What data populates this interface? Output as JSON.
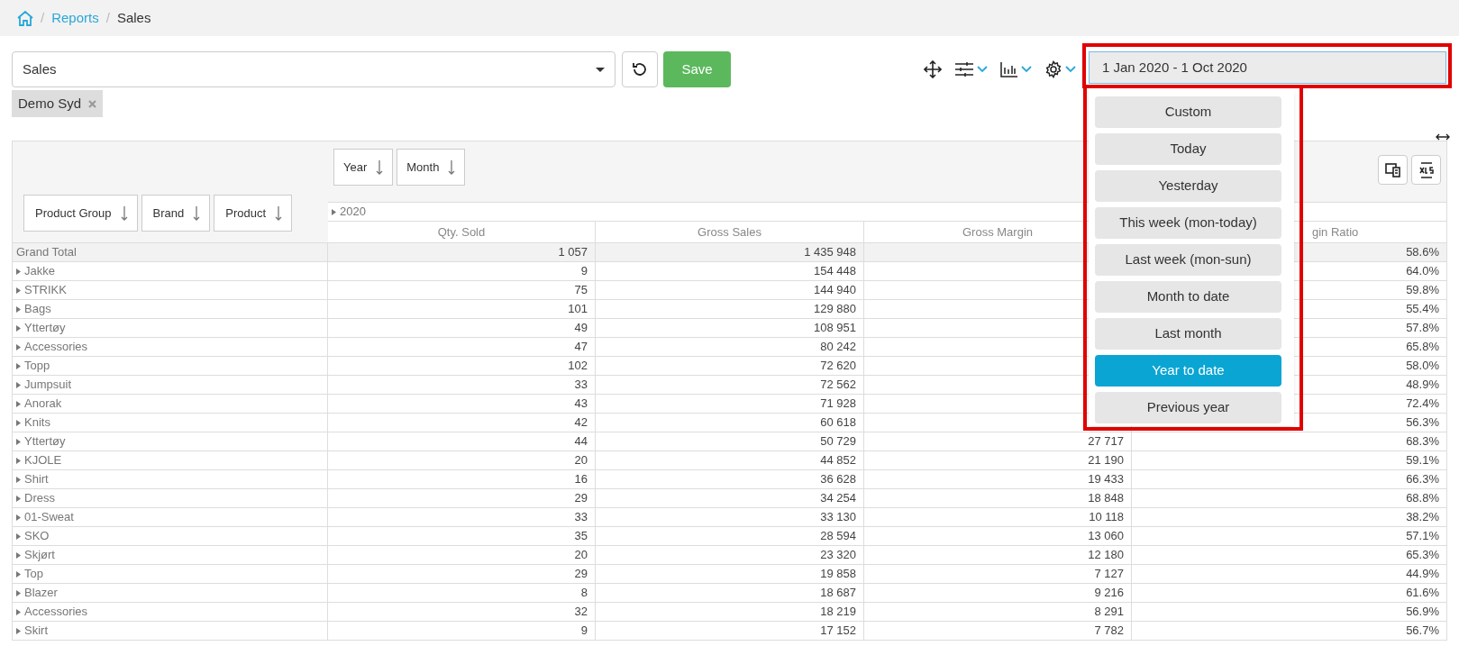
{
  "breadcrumb": [
    {
      "separator": "/",
      "label": "Reports",
      "link": true
    },
    {
      "separator": "/",
      "label": "Sales",
      "link": false
    }
  ],
  "report_select": {
    "value": "Sales"
  },
  "save_button": "Save",
  "filter_tags": [
    "Demo Syd"
  ],
  "date_range": {
    "value": "1 Jan 2020 - 1 Oct 2020"
  },
  "date_presets": [
    {
      "label": "Custom",
      "selected": false
    },
    {
      "label": "Today",
      "selected": false
    },
    {
      "label": "Yesterday",
      "selected": false
    },
    {
      "label": "This week (mon-today)",
      "selected": false
    },
    {
      "label": "Last week (mon-sun)",
      "selected": false
    },
    {
      "label": "Month to date",
      "selected": false
    },
    {
      "label": "Last month",
      "selected": false
    },
    {
      "label": "Year to date",
      "selected": true
    },
    {
      "label": "Previous year",
      "selected": false
    }
  ],
  "pivot": {
    "column_fields": [
      "Year",
      "Month"
    ],
    "row_fields": [
      "Product Group",
      "Brand",
      "Product"
    ],
    "column_group": "2020",
    "columns": [
      "Qty. Sold",
      "Gross Sales",
      "Gross Margin",
      "gin Ratio"
    ],
    "rows": [
      {
        "name": "Grand Total",
        "expandable": false,
        "cells": [
          "1 057",
          "1 435 948",
          null,
          "58.6%"
        ]
      },
      {
        "name": "Jakke",
        "expandable": true,
        "cells": [
          "9",
          "154 448",
          null,
          "64.0%"
        ]
      },
      {
        "name": "STRIKK",
        "expandable": true,
        "cells": [
          "75",
          "144 940",
          null,
          "59.8%"
        ]
      },
      {
        "name": "Bags",
        "expandable": true,
        "cells": [
          "101",
          "129 880",
          null,
          "55.4%"
        ]
      },
      {
        "name": "Yttertøy",
        "expandable": true,
        "cells": [
          "49",
          "108 951",
          null,
          "57.8%"
        ]
      },
      {
        "name": "Accessories",
        "expandable": true,
        "cells": [
          "47",
          "80 242",
          null,
          "65.8%"
        ]
      },
      {
        "name": "Topp",
        "expandable": true,
        "cells": [
          "102",
          "72 620",
          null,
          "58.0%"
        ]
      },
      {
        "name": "Jumpsuit",
        "expandable": true,
        "cells": [
          "33",
          "72 562",
          null,
          "48.9%"
        ]
      },
      {
        "name": "Anorak",
        "expandable": true,
        "cells": [
          "43",
          "71 928",
          null,
          "72.4%"
        ]
      },
      {
        "name": "Knits",
        "expandable": true,
        "cells": [
          "42",
          "60 618",
          null,
          "56.3%"
        ]
      },
      {
        "name": "Yttertøy",
        "expandable": true,
        "cells": [
          "44",
          "50 729",
          "27 717",
          "68.3%"
        ]
      },
      {
        "name": "KJOLE",
        "expandable": true,
        "cells": [
          "20",
          "44 852",
          "21 190",
          "59.1%"
        ]
      },
      {
        "name": "Shirt",
        "expandable": true,
        "cells": [
          "16",
          "36 628",
          "19 433",
          "66.3%"
        ]
      },
      {
        "name": "Dress",
        "expandable": true,
        "cells": [
          "29",
          "34 254",
          "18 848",
          "68.8%"
        ]
      },
      {
        "name": "01-Sweat",
        "expandable": true,
        "cells": [
          "33",
          "33 130",
          "10 118",
          "38.2%"
        ]
      },
      {
        "name": "SKO",
        "expandable": true,
        "cells": [
          "35",
          "28 594",
          "13 060",
          "57.1%"
        ]
      },
      {
        "name": "Skjørt",
        "expandable": true,
        "cells": [
          "20",
          "23 320",
          "12 180",
          "65.3%"
        ]
      },
      {
        "name": "Top",
        "expandable": true,
        "cells": [
          "29",
          "19 858",
          "7 127",
          "44.9%"
        ]
      },
      {
        "name": "Blazer",
        "expandable": true,
        "cells": [
          "8",
          "18 687",
          "9 216",
          "61.6%"
        ]
      },
      {
        "name": "Accessories",
        "expandable": true,
        "cells": [
          "32",
          "18 219",
          "8 291",
          "56.9%"
        ]
      },
      {
        "name": "Skirt",
        "expandable": true,
        "cells": [
          "9",
          "17 152",
          "7 782",
          "56.7%"
        ]
      }
    ]
  }
}
